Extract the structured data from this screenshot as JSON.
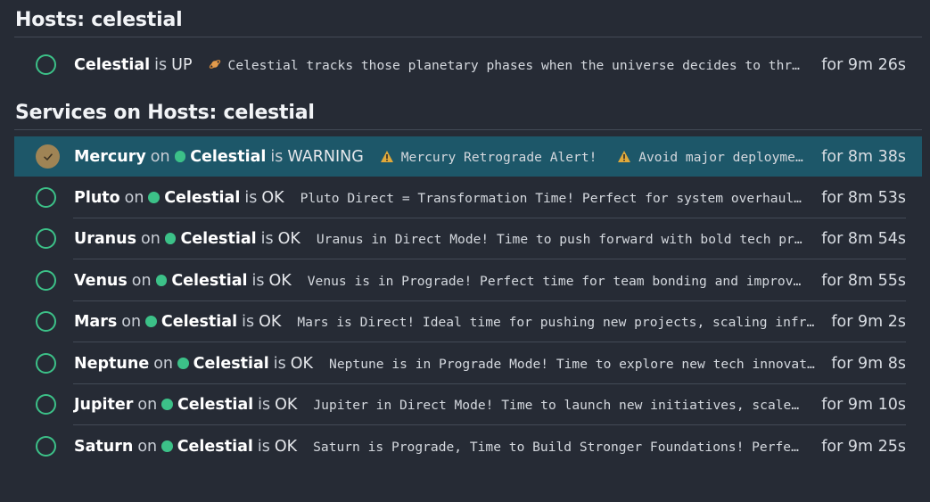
{
  "hosts_section": {
    "title": "Hosts: celestial"
  },
  "host": {
    "name": "Celestial",
    "is_word": "is",
    "state": "UP",
    "output": "Celestial tracks those planetary phases when the universe decides to thr…",
    "duration": "for 9m 26s",
    "icon": "ringed-planet-icon"
  },
  "services_section": {
    "title": "Services on Hosts: celestial"
  },
  "services": [
    {
      "name": "Mercury",
      "on_word": "on",
      "host": "Celestial",
      "is_word": "is",
      "state": "WARNING",
      "output_a": "Mercury Retrograde Alert!",
      "output_b": "Avoid major deployment…",
      "duration": "for 8m 38s"
    },
    {
      "name": "Pluto",
      "on_word": "on",
      "host": "Celestial",
      "is_word": "is",
      "state": "OK",
      "output": "Pluto Direct = Transformation Time! Perfect for system overhauls,…",
      "duration": "for 8m 53s"
    },
    {
      "name": "Uranus",
      "on_word": "on",
      "host": "Celestial",
      "is_word": "is",
      "state": "OK",
      "output": "Uranus in Direct Mode! Time to push forward with bold tech proj…",
      "duration": "for 8m 54s"
    },
    {
      "name": "Venus",
      "on_word": "on",
      "host": "Celestial",
      "is_word": "is",
      "state": "OK",
      "output": "Venus is in Prograde! Perfect time for team bonding and improvin…",
      "duration": "for 8m 55s"
    },
    {
      "name": "Mars",
      "on_word": "on",
      "host": "Celestial",
      "is_word": "is",
      "state": "OK",
      "output": "Mars is Direct! Ideal time for pushing new projects, scaling infra…",
      "duration": "for 9m 2s"
    },
    {
      "name": "Neptune",
      "on_word": "on",
      "host": "Celestial",
      "is_word": "is",
      "state": "OK",
      "output": "Neptune is in Prograde Mode! Time to explore new tech innovatio…",
      "duration": "for 9m 8s"
    },
    {
      "name": "Jupiter",
      "on_word": "on",
      "host": "Celestial",
      "is_word": "is",
      "state": "OK",
      "output": "Jupiter in Direct Mode! Time to launch new initiatives, scale i…",
      "duration": "for 9m 10s"
    },
    {
      "name": "Saturn",
      "on_word": "on",
      "host": "Celestial",
      "is_word": "is",
      "state": "OK",
      "output": "Saturn is Prograde, Time to Build Stronger Foundations! Perfect …",
      "duration": "for 9m 25s"
    }
  ],
  "colors": {
    "background": "#262b35",
    "ok": "#3cc188",
    "warning": "#9f8455",
    "warning_icon": "#e0a93a",
    "highlight_row": "#1d5769"
  }
}
